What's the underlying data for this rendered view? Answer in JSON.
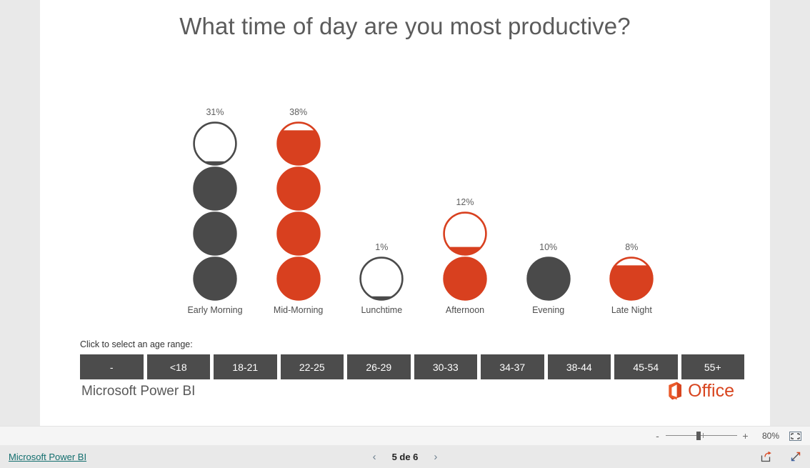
{
  "report": {
    "title": "What time of day are you most productive?",
    "brand": "Microsoft Power BI",
    "office_label": "Office"
  },
  "colors": {
    "red": "#d8401f",
    "gray": "#4a4a4a",
    "canvas": "#ffffff",
    "page_background": "#e9e9e9",
    "slicer_button": "#4c4c4c",
    "link": "#126e6e",
    "office_orange": "#d8451f"
  },
  "slicer": {
    "caption": "Click to select an age range:",
    "options": [
      {
        "label": "-"
      },
      {
        "label": "<18"
      },
      {
        "label": "18-21"
      },
      {
        "label": "22-25"
      },
      {
        "label": "26-29"
      },
      {
        "label": "30-33"
      },
      {
        "label": "34-37"
      },
      {
        "label": "38-44"
      },
      {
        "label": "45-54"
      },
      {
        "label": "55+"
      }
    ]
  },
  "viewbar": {
    "zoom_out_label": "-",
    "zoom_in_label": "+",
    "zoom_level": "80%",
    "fit_icon": "fit-to-page-icon"
  },
  "statusbar": {
    "link_label": "Microsoft Power BI",
    "prev_label": "‹",
    "page_label": "5 de 6",
    "next_label": "›",
    "share_icon": "share-icon",
    "fullscreen_icon": "fullscreen-icon"
  },
  "chart_data": {
    "type": "bar",
    "title": "What time of day are you most productive?",
    "xlabel": "",
    "ylabel": "",
    "unit": "percent",
    "glyph": "circle",
    "glyph_value": 10,
    "note": "Pictogram/infographic bar chart: each circle represents 10%; partially-filled top circle shows the remainder. Red circles = highlighted/selected series, dark gray = unhighlighted.",
    "categories": [
      "Early Morning",
      "Mid-Morning",
      "Lunchtime",
      "Afternoon",
      "Evening",
      "Late Night"
    ],
    "values": [
      31,
      38,
      1,
      12,
      10,
      8
    ],
    "value_labels": [
      "31%",
      "38%",
      "1%",
      "12%",
      "10%",
      "8%"
    ],
    "colors": [
      "#4a4a4a",
      "#d8401f",
      "#4a4a4a",
      "#d8401f",
      "#4a4a4a",
      "#d8401f"
    ],
    "ylim": [
      0,
      40
    ]
  }
}
